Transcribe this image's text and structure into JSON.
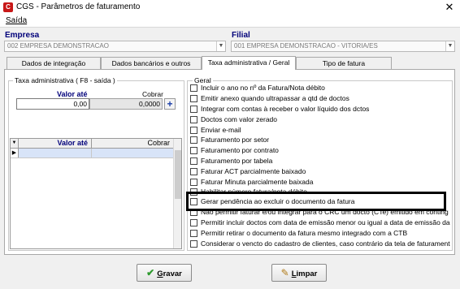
{
  "window": {
    "title": "CGS - Parâmetros de faturamento",
    "close_glyph": "✕",
    "icon_letter": "C"
  },
  "menu": {
    "items": [
      "Saída"
    ]
  },
  "empresa": {
    "label": "Empresa",
    "value": "002 EMPRESA DEMONSTRACAO"
  },
  "filial": {
    "label": "Filial",
    "value": "001 EMPRESA DEMONSTRACAO - VITORIA/ES"
  },
  "tabs": [
    "Dados de integração",
    "Dados bancários e outros",
    "Taxa administrativa / Geral",
    "Tipo de fatura"
  ],
  "taxa": {
    "legend": "Taxa administrativa ( F8 - saída )",
    "valor_ate_label": "Valor até",
    "cobrar_label": "Cobrar",
    "valor_ate_value": "0,00",
    "cobrar_value": "0,0000",
    "add_glyph": "+",
    "grid_headers": [
      "Valor até",
      "Cobrar"
    ]
  },
  "geral": {
    "legend": "Geral",
    "options": [
      "Incluir o ano no nº da Fatura/Nota débito",
      "Emitir anexo quando ultrapassar a qtd de doctos",
      "Integrar com contas à receber o valor líquido dos dctos",
      "Doctos com valor zerado",
      "Enviar e-mail",
      "Faturamento por setor",
      "Faturamento por contrato",
      "Faturamento por tabela",
      "Faturar ACT parcialmente baixado",
      "Faturar Minuta parcialmente baixada",
      "Habilitar número fatura/nota débito",
      "Gerar pendência ao excluir o documento da fatura",
      "Não permitir faturar e/ou integrar para o CRC um docto (CTe) emitido em contingência",
      "Permitir incluir doctos com data de emissão menor ou igual a data de emissão da fatura",
      "Permitir retirar o documento da fatura mesmo integrado com a CTB",
      "Considerar o vencto do cadastro de clientes, caso contrário da tela de faturamento"
    ],
    "highlighted_option": "Gerar pendência ao excluir o documento da fatura"
  },
  "buttons": {
    "gravar": {
      "mnemonic": "G",
      "rest": "ravar",
      "icon_glyph": "✔"
    },
    "limpar": {
      "mnemonic": "L",
      "rest": "impar",
      "icon_glyph": "✎"
    }
  },
  "colors": {
    "accent_label": "#00007a",
    "highlight_border": "#000000",
    "grid_selected": "#d8e4f8",
    "gravar_icon": "#2e9a2e",
    "limpar_icon": "#b07a18"
  }
}
